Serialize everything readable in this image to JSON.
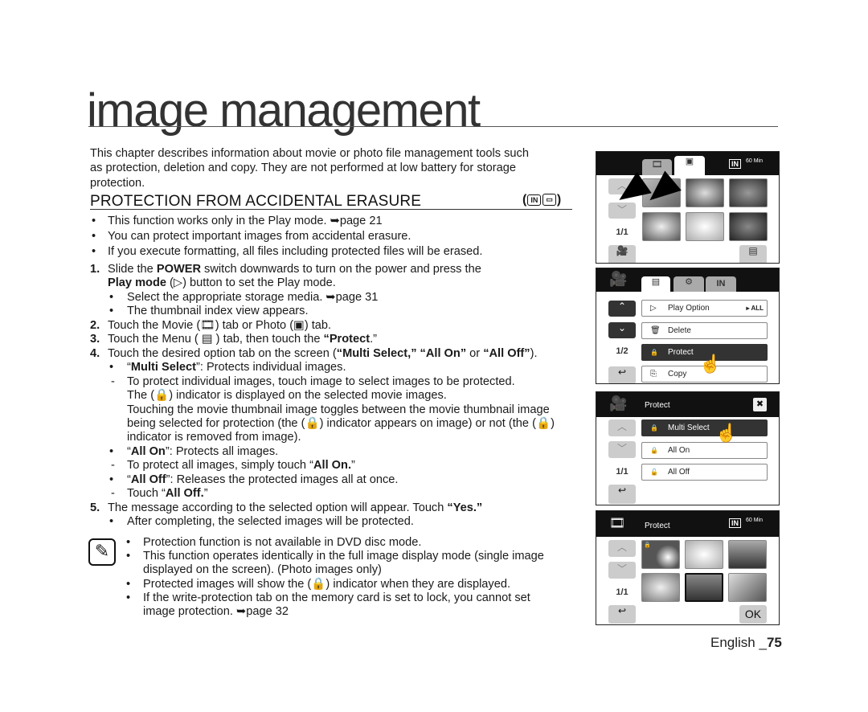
{
  "page_title": "image management",
  "intro": [
    {
      "kind": "plain",
      "segs": [
        {
          "t": "This chapter describes information about movie or photo file management tools such"
        }
      ]
    },
    {
      "kind": "plain",
      "segs": [
        {
          "t": "as protection, deletion and copy. They are not performed at low battery for storage"
        }
      ]
    },
    {
      "kind": "plain",
      "segs": [
        {
          "t": "protection."
        }
      ]
    }
  ],
  "section_heading": "PROTECTION FROM ACCIDENTAL ERASURE",
  "mode_icons": [
    "IN",
    "▭"
  ],
  "top_bullets": [
    {
      "kind": "tb",
      "mark": "•",
      "segs": [
        {
          "t": "This function works only in the Play mode. ➥page 21"
        }
      ]
    },
    {
      "kind": "tb",
      "mark": "•",
      "segs": [
        {
          "t": "You can protect important images from accidental erasure."
        }
      ]
    },
    {
      "kind": "tb",
      "mark": "•",
      "segs": [
        {
          "t": "If you execute formatting, all files including protected files will be erased."
        }
      ]
    }
  ],
  "steps": [
    {
      "kind": "num",
      "mark": "1.",
      "segs": [
        {
          "t": "Slide the "
        },
        {
          "t": "POWER",
          "b": true
        },
        {
          "t": " switch downwards to turn on the power and press the"
        }
      ]
    },
    {
      "kind": "numc",
      "segs": [
        {
          "t": "Play mode",
          "b": true
        },
        {
          "t": " (▷) button to set the Play mode."
        }
      ]
    },
    {
      "kind": "bul",
      "mark": "•",
      "segs": [
        {
          "t": "Select the appropriate storage media. ➥page 31"
        }
      ]
    },
    {
      "kind": "bul",
      "mark": "•",
      "segs": [
        {
          "t": "The thumbnail index view appears."
        }
      ]
    },
    {
      "kind": "num",
      "mark": "2.",
      "segs": [
        {
          "t": "Touch the Movie (🎞) tab or Photo (▣) tab."
        }
      ]
    },
    {
      "kind": "num",
      "mark": "3.",
      "segs": [
        {
          "t": "Touch the Menu ( ▤ ) tab, then touch the "
        },
        {
          "t": "“Protect",
          "b": true
        },
        {
          "t": ".”"
        }
      ]
    },
    {
      "kind": "num",
      "mark": "4.",
      "segs": [
        {
          "t": "Touch the desired option tab on the screen ("
        },
        {
          "t": "“Multi Select,” “All On”",
          "b": true
        },
        {
          "t": " or "
        },
        {
          "t": "“All Off”",
          "b": true
        },
        {
          "t": ")."
        }
      ]
    },
    {
      "kind": "bul",
      "mark": "•",
      "segs": [
        {
          "t": "“"
        },
        {
          "t": "Multi Select",
          "b": true
        },
        {
          "t": "”: Protects individual images."
        }
      ]
    },
    {
      "kind": "dash",
      "mark": "-",
      "segs": [
        {
          "t": "To protect individual images, touch image to select images to be protected."
        }
      ]
    },
    {
      "kind": "cont",
      "segs": [
        {
          "t": "The (🔒) indicator is displayed on the selected movie images."
        }
      ]
    },
    {
      "kind": "cont",
      "segs": [
        {
          "t": "Touching the movie thumbnail image toggles between the movie thumbnail image"
        }
      ]
    },
    {
      "kind": "cont",
      "segs": [
        {
          "t": "being selected for protection (the (🔒) indicator appears on image) or not (the (🔒)"
        }
      ]
    },
    {
      "kind": "cont",
      "segs": [
        {
          "t": "indicator is removed from image)."
        }
      ]
    },
    {
      "kind": "bul",
      "mark": "•",
      "segs": [
        {
          "t": "“"
        },
        {
          "t": "All On",
          "b": true
        },
        {
          "t": "”: Protects all images."
        }
      ]
    },
    {
      "kind": "dash",
      "mark": "-",
      "segs": [
        {
          "t": "To protect all images, simply touch “"
        },
        {
          "t": "All On.",
          "b": true
        },
        {
          "t": "”"
        }
      ]
    },
    {
      "kind": "bul",
      "mark": "•",
      "segs": [
        {
          "t": "“"
        },
        {
          "t": "All Off",
          "b": true
        },
        {
          "t": "”: Releases the protected images all at once."
        }
      ]
    },
    {
      "kind": "dash",
      "mark": "-",
      "segs": [
        {
          "t": "Touch “"
        },
        {
          "t": "All Off.",
          "b": true
        },
        {
          "t": "”"
        }
      ]
    },
    {
      "kind": "num",
      "mark": "5.",
      "segs": [
        {
          "t": "The message according to the selected option will appear. Touch "
        },
        {
          "t": "“Yes.”",
          "b": true
        }
      ]
    },
    {
      "kind": "bul",
      "mark": "•",
      "segs": [
        {
          "t": "After completing, the selected images will be protected."
        }
      ]
    }
  ],
  "notes": [
    {
      "kind": "nb",
      "mark": "•",
      "segs": [
        {
          "t": "Protection function is not available in DVD disc mode."
        }
      ]
    },
    {
      "kind": "nb",
      "mark": "•",
      "segs": [
        {
          "t": "This function operates identically in the full image display mode (single image"
        }
      ]
    },
    {
      "kind": "nc",
      "segs": [
        {
          "t": "displayed on the screen). (Photo images only)"
        }
      ]
    },
    {
      "kind": "nb",
      "mark": "•",
      "segs": [
        {
          "t": "Protected images will show the (🔒) indicator when they are displayed."
        }
      ]
    },
    {
      "kind": "nb",
      "mark": "•",
      "segs": [
        {
          "t": "If the write-protection tab on the memory card is set to lock, you cannot set"
        }
      ]
    },
    {
      "kind": "nc",
      "segs": [
        {
          "t": "image protection. ➥page 32"
        }
      ]
    }
  ],
  "note_icon": "pencil-note-icon",
  "footer": {
    "lang": "English _",
    "page": "75"
  },
  "screens": {
    "s1": {
      "page": "1/1",
      "storage": "IN",
      "battery": "60 Min"
    },
    "s2": {
      "page": "1/2",
      "menu": [
        {
          "label": "Play Option",
          "value": "▸ ALL",
          "icon": "▷"
        },
        {
          "label": "Delete",
          "icon": "🗑"
        },
        {
          "label": "Protect",
          "icon": "🔒"
        },
        {
          "label": "Copy",
          "icon": "⎘"
        }
      ],
      "tab_storage": "IN"
    },
    "s3": {
      "title": "Protect",
      "page": "1/1",
      "options": [
        {
          "label": "Multi Select",
          "icon": "🔒"
        },
        {
          "label": "All On",
          "icon": "🔒"
        },
        {
          "label": "All Off",
          "icon": "🔓"
        }
      ],
      "close": "✖"
    },
    "s4": {
      "title": "Protect",
      "page": "1/1",
      "storage": "IN",
      "battery": "60 Min",
      "ok": "OK"
    }
  }
}
